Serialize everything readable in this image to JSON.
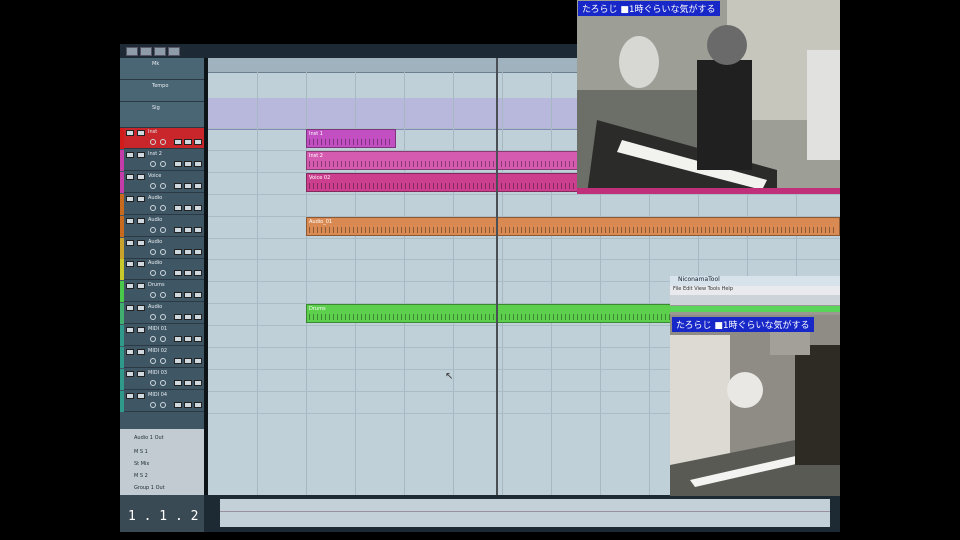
{
  "tracks": [
    {
      "label": "Inst",
      "color": "#d21c1c",
      "selected": true
    },
    {
      "label": "Inst 2",
      "color": "#c33ca8"
    },
    {
      "label": "Voice",
      "color": "#c33ca8"
    },
    {
      "label": "Audio",
      "color": "#c86a1e"
    },
    {
      "label": "Audio",
      "color": "#c86a1e"
    },
    {
      "label": "Audio",
      "color": "#c8a22a"
    },
    {
      "label": "Audio",
      "color": "#c8c82a"
    },
    {
      "label": "Drums",
      "color": "#4ac84a"
    },
    {
      "label": "Audio",
      "color": "#3fae6e"
    },
    {
      "label": "MIDI 01",
      "color": "#2f9a8a"
    },
    {
      "label": "MIDI 02",
      "color": "#2f9a8a"
    },
    {
      "label": "MIDI 03",
      "color": "#2f9a8a"
    },
    {
      "label": "MIDI 04",
      "color": "#2f9a8a"
    }
  ],
  "header_rows": {
    "row1": "Mk",
    "row2": "Tempo",
    "row3": "Sig"
  },
  "clips": [
    {
      "name": "Inst 1",
      "color": "#c24fc2",
      "track": 0
    },
    {
      "name": "Inst 2",
      "color": "#d45bb0",
      "track": 1
    },
    {
      "name": "Voice 02",
      "color": "#cc3f8f",
      "track": 2
    },
    {
      "name": "Audio_01",
      "color": "#d98a52",
      "track": 4
    },
    {
      "name": "Drums",
      "color": "#5ccf4c",
      "track": 8
    }
  ],
  "mini_window": {
    "title": "Audio 1 Out",
    "items": [
      "M S 1",
      "St Mix",
      "M S 2",
      "Group 1 Out"
    ]
  },
  "counter": "1 . 1 . 2",
  "overlay1_caption": "たろらじ  ■1時ぐらいな気がする",
  "overlay2_title": "NiconamaTool",
  "overlay2_menu": "File  Edit  View  Tools  Help",
  "overlay2_caption": "たろらじ  ■1時ぐらいな気がする",
  "colors": {
    "daw_bg": "#b9c8d2",
    "tracklist": "#3f5664",
    "tempo_lane": "#b7b8dc",
    "caption_bg": "#1828c8"
  }
}
